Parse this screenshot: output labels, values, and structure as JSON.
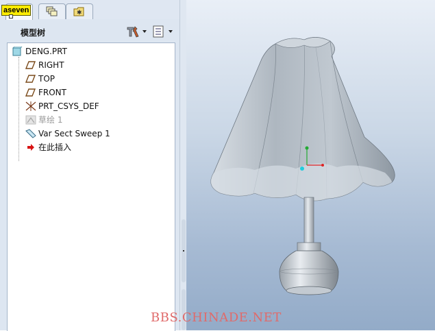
{
  "tag_label": "aseven",
  "tabs": [
    {
      "name": "model-tree-tab",
      "icon": "model-tree-tab-icon"
    },
    {
      "name": "layers-tab",
      "icon": "layers-icon"
    },
    {
      "name": "favorites-tab",
      "icon": "folder-star-icon"
    }
  ],
  "panel": {
    "title": "模型树",
    "settings_icon": "tools-icon",
    "show_icon": "list-icon"
  },
  "tree": {
    "items": [
      {
        "label": "DENG.PRT",
        "icon": "part-icon"
      },
      {
        "label": "RIGHT",
        "icon": "datum-plane-icon"
      },
      {
        "label": "TOP",
        "icon": "datum-plane-icon"
      },
      {
        "label": "FRONT",
        "icon": "datum-plane-icon"
      },
      {
        "label": "PRT_CSYS_DEF",
        "icon": "csys-icon"
      },
      {
        "label": "草绘 1",
        "icon": "sketch-icon"
      },
      {
        "label": "Var Sect Sweep 1",
        "icon": "sweep-icon"
      },
      {
        "label": "在此插入",
        "icon": "insert-here-arrow-icon"
      }
    ]
  },
  "viewport": {
    "model": "lamp",
    "colors": {
      "shade": "#b8c2cc",
      "stem": "#9aa4ad",
      "axis_y": "#22aa33",
      "axis_x": "#dd2222",
      "axis_z": "#22ccdd"
    }
  },
  "watermark": "BBS.CHINADE.NET"
}
